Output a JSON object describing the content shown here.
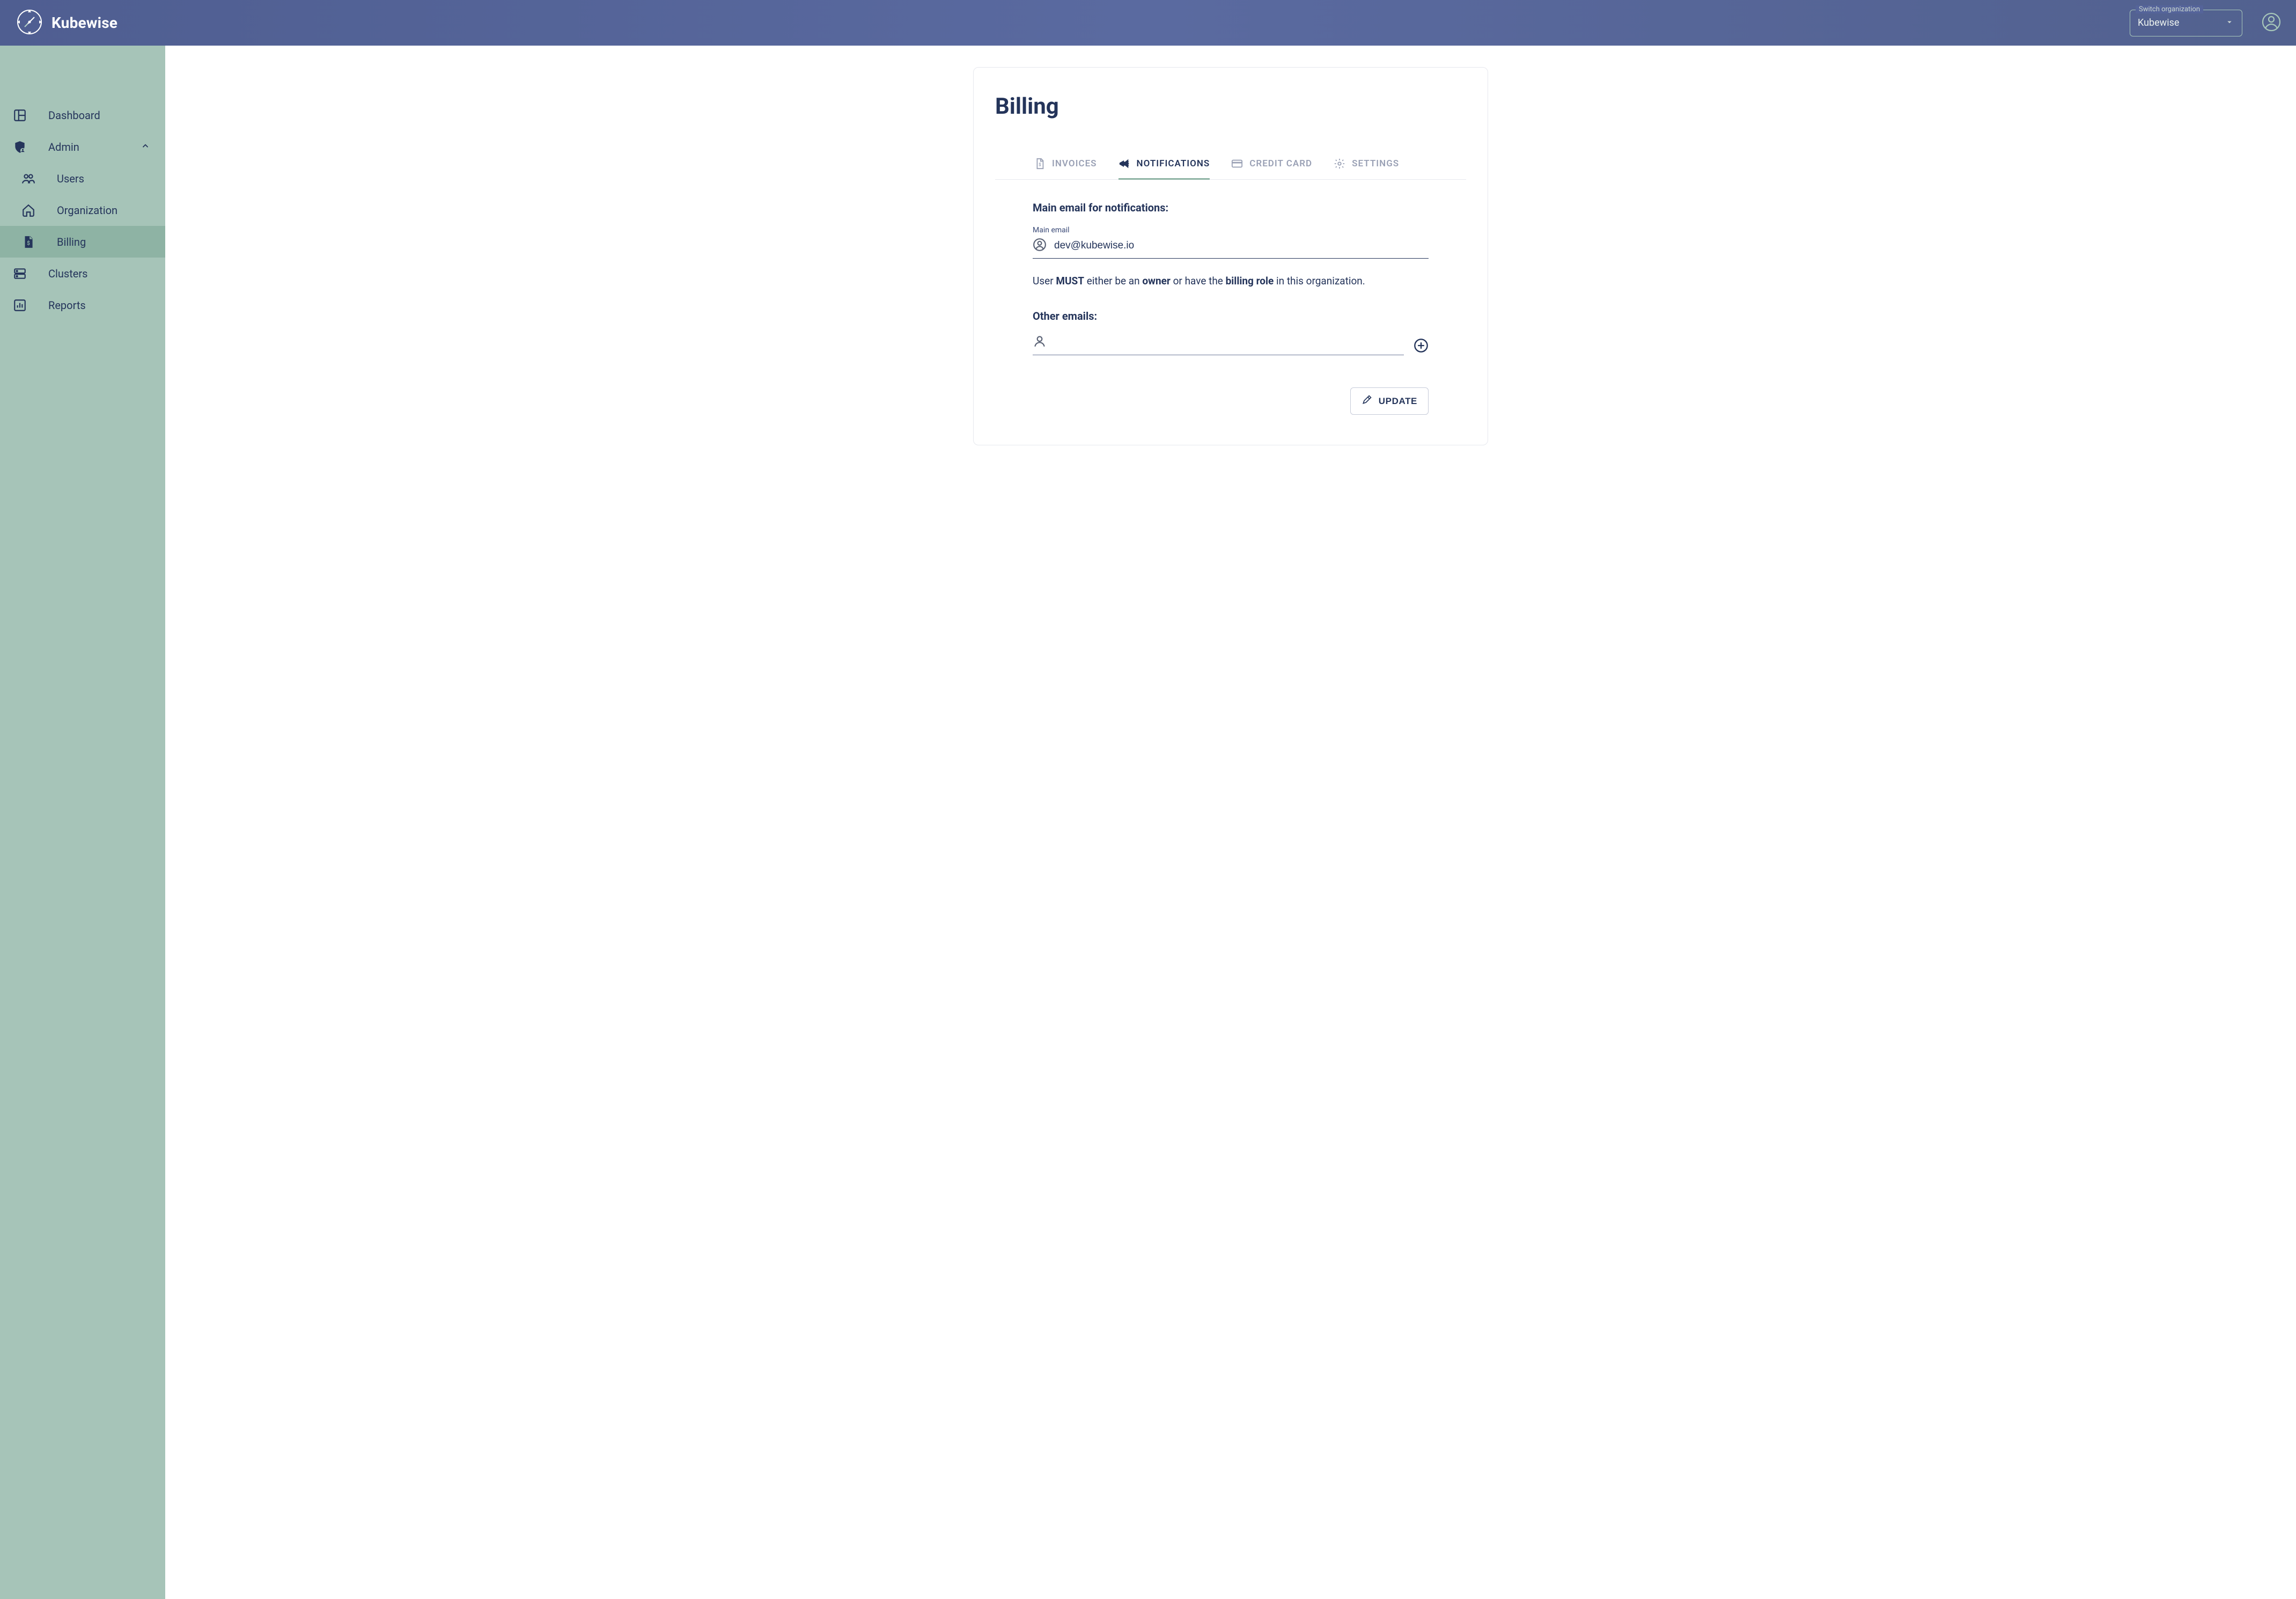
{
  "header": {
    "brand_name": "Kubewise",
    "org_switch_label": "Switch organization",
    "org_switch_value": "Kubewise"
  },
  "sidebar": {
    "items": [
      {
        "label": "Dashboard"
      },
      {
        "label": "Admin"
      },
      {
        "label": "Clusters"
      },
      {
        "label": "Reports"
      }
    ],
    "admin_children": [
      {
        "label": "Users"
      },
      {
        "label": "Organization"
      },
      {
        "label": "Billing"
      }
    ]
  },
  "page": {
    "title": "Billing",
    "tabs": [
      {
        "label": "INVOICES"
      },
      {
        "label": "NOTIFICATIONS"
      },
      {
        "label": "CREDIT CARD"
      },
      {
        "label": "SETTINGS"
      }
    ],
    "notifications": {
      "main_heading": "Main email for notifications:",
      "main_label": "Main email",
      "main_value": "dev@kubewise.io",
      "helper_pre": "User ",
      "helper_must": "MUST",
      "helper_mid1": " either be an ",
      "helper_owner": "owner",
      "helper_mid2": " or have the ",
      "helper_role": "billing role",
      "helper_post": " in this organization.",
      "other_heading": "Other emails:",
      "other_value": "",
      "update_label": "UPDATE"
    }
  }
}
